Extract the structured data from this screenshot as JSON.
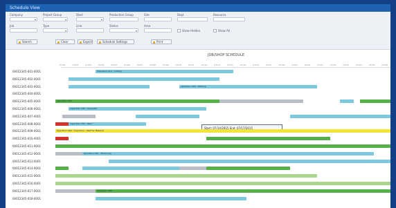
{
  "window": {
    "title": "Schedule View"
  },
  "colors": {
    "frame": "#123f86",
    "titlebar": "#1e62b4",
    "bar_blue": "#7cc8df",
    "bar_green": "#56b04a",
    "bar_light_green": "#a8d48c",
    "bar_yellow": "#f4e33a",
    "bar_red": "#d6312c",
    "bar_gray": "#b9bec6"
  },
  "filters": {
    "row1_labels": [
      "Company",
      "Project Group",
      "Start",
      "Production Group",
      "Site",
      "Dept",
      "Resource"
    ],
    "row2_labels": [
      "Job",
      "Type",
      "Line",
      "Status",
      "Area",
      "Show Hidden",
      "Show All"
    ],
    "buttons": [
      "Search",
      "Clear",
      "Export",
      "Schedule Settings",
      "Print"
    ],
    "icons": [
      "search-icon",
      "clear-icon",
      "export-icon",
      "settings-icon",
      "print-icon"
    ]
  },
  "chart": {
    "title": "JOB/SHOP SCHEDULE"
  },
  "timeline": {
    "ticks": [
      "07/01",
      "07/02",
      "07/03",
      "07/04",
      "07/05",
      "07/06",
      "07/07",
      "07/08",
      "07/09",
      "07/10",
      "07/11",
      "07/12",
      "07/13",
      "07/14",
      "07/15",
      "07/16",
      "07/17",
      "07/18",
      "07/19",
      "07/20",
      "07/21",
      "07/22",
      "07/23",
      "07/24",
      "07/25",
      "07/26"
    ]
  },
  "rows": [
    {
      "label": "00012345-001-0001",
      "bars": [
        {
          "s": 0.12,
          "e": 0.53,
          "c": "blue",
          "t": "Operation 010 - Cutting"
        }
      ]
    },
    {
      "label": "00012345-002-0001",
      "bars": [
        {
          "s": 0.04,
          "e": 0.49,
          "c": "blue",
          "t": ""
        }
      ]
    },
    {
      "label": "00012345-003-0001",
      "bars": [
        {
          "s": 0.04,
          "e": 0.28,
          "c": "blue",
          "t": ""
        },
        {
          "s": 0.37,
          "e": 0.78,
          "c": "blue",
          "t": "Operation 020 - Welding"
        }
      ]
    },
    {
      "label": "00012345-004-0001",
      "bars": []
    },
    {
      "label": "00012345-005-0001",
      "bars": [
        {
          "s": 0.0,
          "e": 0.49,
          "c": "green",
          "t": "Operation 030"
        },
        {
          "s": 0.49,
          "e": 0.74,
          "c": "gray",
          "t": ""
        },
        {
          "s": 0.85,
          "e": 0.89,
          "c": "blue",
          "t": ""
        },
        {
          "s": 0.91,
          "e": 1.0,
          "c": "green",
          "t": ""
        }
      ]
    },
    {
      "label": "00012345-006-0001",
      "bars": [
        {
          "s": 0.04,
          "e": 0.45,
          "c": "blue",
          "t": "Operation 040 - Assembly"
        }
      ]
    },
    {
      "label": "00012345-007-0001",
      "bars": [
        {
          "s": 0.02,
          "e": 0.12,
          "c": "gray",
          "t": ""
        },
        {
          "s": 0.24,
          "e": 0.43,
          "c": "blue",
          "t": ""
        },
        {
          "s": 0.7,
          "e": 1.0,
          "c": "blue",
          "t": ""
        }
      ]
    },
    {
      "label": "00012345-008-0001",
      "bars": [
        {
          "s": 0.0,
          "e": 0.04,
          "c": "red",
          "t": ""
        },
        {
          "s": 0.04,
          "e": 0.27,
          "c": "blue",
          "t": "Operation 050 - Paint"
        }
      ]
    },
    {
      "label": "00012345-009-0001",
      "bars": [
        {
          "s": 0.0,
          "e": 1.0,
          "c": "yellow",
          "t": "Operation 060 - Inspection - Wait for Material"
        }
      ]
    },
    {
      "label": "00012345-010-0001",
      "bars": [
        {
          "s": 0.0,
          "e": 0.04,
          "c": "red",
          "t": ""
        },
        {
          "s": 0.45,
          "e": 0.82,
          "c": "green",
          "t": ""
        }
      ]
    },
    {
      "label": "00012345-011-0001",
      "bars": [
        {
          "s": 0.0,
          "e": 1.0,
          "c": "green",
          "t": ""
        }
      ]
    },
    {
      "label": "00012345-012-0001",
      "bars": [
        {
          "s": 0.0,
          "e": 0.08,
          "c": "gray",
          "t": ""
        },
        {
          "s": 0.08,
          "e": 0.95,
          "c": "blue",
          "t": "Operation 070 - Machining"
        }
      ]
    },
    {
      "label": "00012345-013-0001",
      "bars": [
        {
          "s": 0.16,
          "e": 1.0,
          "c": "blue",
          "t": ""
        }
      ]
    },
    {
      "label": "00012345-014-0001",
      "bars": [
        {
          "s": 0.0,
          "e": 0.04,
          "c": "green",
          "t": ""
        },
        {
          "s": 0.08,
          "e": 0.37,
          "c": "blue",
          "t": ""
        },
        {
          "s": 0.37,
          "e": 0.45,
          "c": "gray",
          "t": ""
        },
        {
          "s": 0.45,
          "e": 0.7,
          "c": "green",
          "t": ""
        }
      ]
    },
    {
      "label": "00012345-015-0001",
      "bars": [
        {
          "s": 0.0,
          "e": 0.78,
          "c": "lgreen",
          "t": ""
        }
      ]
    },
    {
      "label": "00012345-016-0001",
      "bars": [
        {
          "s": 0.0,
          "e": 1.0,
          "c": "lgreen",
          "t": ""
        }
      ]
    },
    {
      "label": "00012345-017-0001",
      "bars": [
        {
          "s": 0.0,
          "e": 0.12,
          "c": "gray",
          "t": ""
        },
        {
          "s": 0.12,
          "e": 1.0,
          "c": "green",
          "t": "Operation 080"
        }
      ]
    },
    {
      "label": "00012345-018-0001",
      "bars": [
        {
          "s": 0.12,
          "e": 0.57,
          "c": "blue",
          "t": ""
        }
      ]
    }
  ],
  "tooltip": {
    "text": "Start: 07/14/2015 End: 07/17/2015"
  }
}
